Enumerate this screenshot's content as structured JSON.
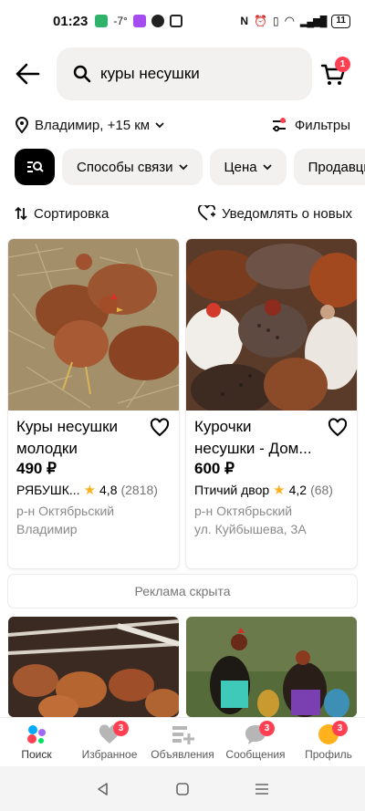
{
  "status": {
    "time": "01:23",
    "temp": "-7°",
    "battery": "11"
  },
  "search": {
    "query": "куры несушки",
    "cart_badge": "1"
  },
  "location": {
    "label": "Владимир, +15 км",
    "filters_label": "Фильтры"
  },
  "chips": [
    "Способы связи",
    "Цена",
    "Продавцы с"
  ],
  "sort": {
    "label": "Сортировка",
    "notify_label": "Уведомлять о новых"
  },
  "listings": [
    {
      "title_line1": "Куры несушки",
      "title_line2": "молодки",
      "price": "490 ₽",
      "seller": "РЯБУШК...",
      "rating": "4,8",
      "reviews": "(2818)",
      "addr_line1": "р-н Октябрьский",
      "addr_line2": "Владимир"
    },
    {
      "title_line1": "Курочки",
      "title_line2": "несушки - Дом...",
      "price": "600 ₽",
      "seller": "Птичий двор",
      "rating": "4,2",
      "reviews": "(68)",
      "addr_line1": "р-н Октябрьский",
      "addr_line2": "ул. Куйбышева, 3А"
    }
  ],
  "ad_hidden": "Реклама скрыта",
  "tabs": [
    {
      "label": "Поиск",
      "badge": ""
    },
    {
      "label": "Избранное",
      "badge": "3"
    },
    {
      "label": "Объявления",
      "badge": ""
    },
    {
      "label": "Сообщения",
      "badge": "3"
    },
    {
      "label": "Профиль",
      "badge": "3"
    }
  ],
  "colors": {
    "accent_red": "#ff4053",
    "chip_bg": "#f2f1f0",
    "star": "#ffb020"
  }
}
